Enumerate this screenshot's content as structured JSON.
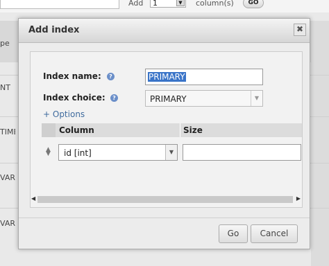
{
  "background": {
    "add_label": "Add",
    "add_count": "1",
    "columns_label": "column(s)",
    "go_label": "GO",
    "row_fragments": [
      "pe",
      "NT",
      "TIME",
      "VARC",
      "VARC"
    ]
  },
  "dialog": {
    "title": "Add index",
    "close_glyph": "✖",
    "index_name_label": "Index name:",
    "index_name_value": "PRIMARY",
    "index_choice_label": "Index choice:",
    "index_choice_value": "PRIMARY",
    "options_link": "+ Options",
    "table": {
      "headers": [
        "Column",
        "Size"
      ],
      "rows": [
        {
          "column": "id [int]",
          "size": ""
        }
      ]
    },
    "buttons": {
      "go": "Go",
      "cancel": "Cancel"
    }
  }
}
